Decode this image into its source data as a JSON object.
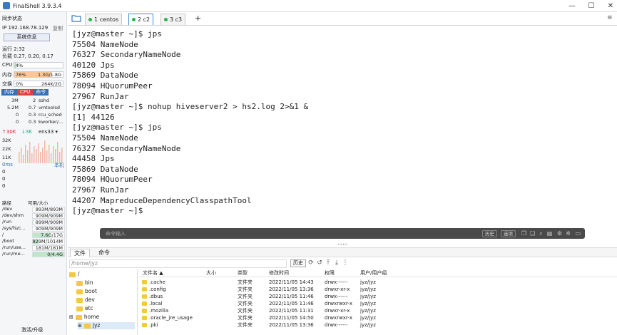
{
  "window": {
    "title": "FinalShell 3.9.3.4"
  },
  "sidebar": {
    "sync_status": "同步状态",
    "ip": "IP 192.168.78.129",
    "copy": "复制",
    "sys_info_btn": "系统信息",
    "uptime": "运行 2:32",
    "load": "负载 0.27, 0.20, 0.17",
    "cpu": {
      "label": "CPU",
      "value": "4%",
      "percent": 4
    },
    "mem": {
      "label": "内存",
      "value": "76%",
      "detail": "1.3G/1.8G",
      "percent": 76
    },
    "swap": {
      "label": "交换",
      "value": "0%",
      "detail": "264K/2G",
      "percent": 0
    },
    "proc_tabs": [
      "内存",
      "CPU",
      "命令"
    ],
    "processes": [
      {
        "mem": "3M",
        "cpu": "2",
        "cmd": "sshd"
      },
      {
        "mem": "5.2M",
        "cpu": "0.7",
        "cmd": "vmtoolsd"
      },
      {
        "mem": "0",
        "cpu": "0.3",
        "cmd": "rcu_sched"
      },
      {
        "mem": "0",
        "cpu": "0.3",
        "cmd": "kworker/..."
      }
    ],
    "net": {
      "up": "↑30K",
      "down": "↓3K",
      "iface": "ens33",
      "ticks": [
        "32K",
        "22K",
        "11K"
      ]
    },
    "ping": {
      "ms": "0ms",
      "host": "本机",
      "vals": [
        "0",
        "0",
        "0"
      ]
    },
    "disk_head": {
      "path": "路径",
      "avail": "可用/大小"
    },
    "disks": [
      {
        "path": "/dev",
        "size": "893M/893M",
        "used": 0
      },
      {
        "path": "/dev/shm",
        "size": "909M/909M",
        "used": 0
      },
      {
        "path": "/run",
        "size": "899M/909M",
        "used": 0.01
      },
      {
        "path": "/sys/fs/c...",
        "size": "909M/909M",
        "used": 0
      },
      {
        "path": "/",
        "size": "7.6G/17G",
        "used": 0.55
      },
      {
        "path": "/boot",
        "size": "829M/1014M",
        "used": 0.18
      },
      {
        "path": "/run/use...",
        "size": "181M/181M",
        "used": 0
      },
      {
        "path": "/run/me...",
        "size": "0/4.4G",
        "used": 1
      }
    ],
    "activate": "激活/升级"
  },
  "tabs": [
    {
      "label": "1 centos"
    },
    {
      "label": "2 c2"
    },
    {
      "label": "3 c3"
    }
  ],
  "terminal": {
    "lines": [
      "[jyz@master ~]$ jps",
      "75504 NameNode",
      "76327 SecondaryNameNode",
      "40120 Jps",
      "75869 DataNode",
      "78094 HQuorumPeer",
      "27967 RunJar",
      "[jyz@master ~]$ nohup hiveserver2 > hs2.log 2>&1 &",
      "[1] 44126",
      "[jyz@master ~]$ jps",
      "75504 NameNode",
      "76327 SecondaryNameNode",
      "44458 Jps",
      "75869 DataNode",
      "78094 HQuorumPeer",
      "27967 RunJar",
      "44207 MapreduceDependencyClasspathTool",
      "[jyz@master ~]$"
    ]
  },
  "cmdbar": {
    "placeholder": "命令输入",
    "history": "历史",
    "options": "选项"
  },
  "filetabs": [
    "文件",
    "命令"
  ],
  "path": {
    "value": "/home/jyz",
    "history": "历史"
  },
  "tree": [
    {
      "label": "/"
    },
    {
      "label": "bin"
    },
    {
      "label": "boot"
    },
    {
      "label": "dev"
    },
    {
      "label": "etc"
    },
    {
      "label": "home"
    },
    {
      "label": "jyz"
    }
  ],
  "files": {
    "headers": {
      "name": "文件名 ▲",
      "size": "大小",
      "type": "类型",
      "mtime": "修改时间",
      "perm": "权限",
      "owner": "用户/用户组"
    },
    "rows": [
      {
        "name": ".cache",
        "type": "文件夹",
        "mtime": "2022/11/05 14:43",
        "perm": "drwx------",
        "owner": "jyz/jyz"
      },
      {
        "name": ".config",
        "type": "文件夹",
        "mtime": "2022/11/05 13:36",
        "perm": "drwxr-xr-x",
        "owner": "jyz/jyz"
      },
      {
        "name": ".dbus",
        "type": "文件夹",
        "mtime": "2022/11/05 11:46",
        "perm": "drwx------",
        "owner": "jyz/jyz"
      },
      {
        "name": ".local",
        "type": "文件夹",
        "mtime": "2022/11/05 11:46",
        "perm": "drwxrwxr-x",
        "owner": "jyz/jyz"
      },
      {
        "name": ".mozilla",
        "type": "文件夹",
        "mtime": "2022/11/05 11:31",
        "perm": "drwxr-xr-x",
        "owner": "jyz/jyz"
      },
      {
        "name": ".oracle_jre_usage",
        "type": "文件夹",
        "mtime": "2022/11/05 14:50",
        "perm": "drwxrwxr-x",
        "owner": "jyz/jyz"
      },
      {
        "name": ".pki",
        "type": "文件夹",
        "mtime": "2022/11/05 13:36",
        "perm": "drwx------",
        "owner": "jyz/jyz"
      }
    ]
  }
}
